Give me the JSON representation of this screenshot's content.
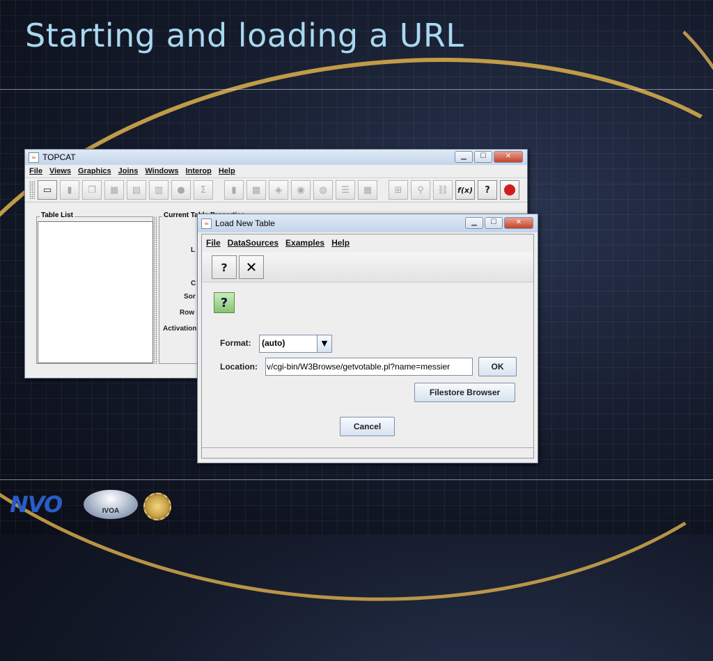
{
  "slide": {
    "title": "Starting and loading a URL"
  },
  "topcat": {
    "title": "TOPCAT",
    "menu": [
      "File",
      "Views",
      "Graphics",
      "Joins",
      "Windows",
      "Interop",
      "Help"
    ],
    "table_list_label": "Table List",
    "current_table_label": "Current Table Properties",
    "field_labels": [
      "L",
      "C",
      "Sor",
      "Row",
      "Activation"
    ],
    "toolbar": {
      "fx": "f(x)",
      "help": "?",
      "sigma": "Σ"
    }
  },
  "load": {
    "title": "Load New Table",
    "menu": [
      "File",
      "DataSources",
      "Examples",
      "Help"
    ],
    "help_glyph": "?",
    "close_glyph": "✕",
    "green_help": "?",
    "format_label": "Format:",
    "format_value": "(auto)",
    "location_label": "Location:",
    "location_value": "v/cgi-bin/W3Browse/getvotable.pl?name=messier",
    "ok": "OK",
    "filestore": "Filestore Browser",
    "cancel": "Cancel"
  },
  "logos": {
    "ivoa": "IVOA",
    "nvo": "NVO"
  }
}
